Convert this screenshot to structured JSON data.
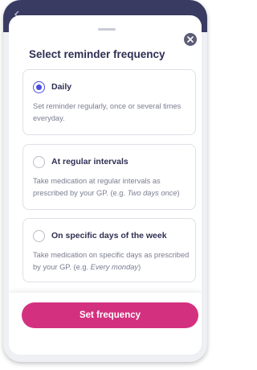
{
  "sheet": {
    "title": "Select reminder frequency",
    "close_icon": "close-icon",
    "back_icon": "chevron-left-icon"
  },
  "options": [
    {
      "label": "Daily",
      "description": "Set reminder regularly, once or several times everyday.",
      "example": "",
      "selected": true
    },
    {
      "label": "At regular intervals",
      "description": "Take medication at regular intervals as prescribed by your GP.  (e.g. ",
      "example": "Two days once",
      "selected": false
    },
    {
      "label": "On specific days of the week",
      "description": "Take medication on specific days as prescribed by your GP. (e.g. ",
      "example": "Every monday",
      "selected": false
    }
  ],
  "footer": {
    "button_label": "Set frequency"
  },
  "colors": {
    "accent": "#4a4de0",
    "brand_pink": "#d3317f",
    "header_navy": "#3a3b62"
  }
}
